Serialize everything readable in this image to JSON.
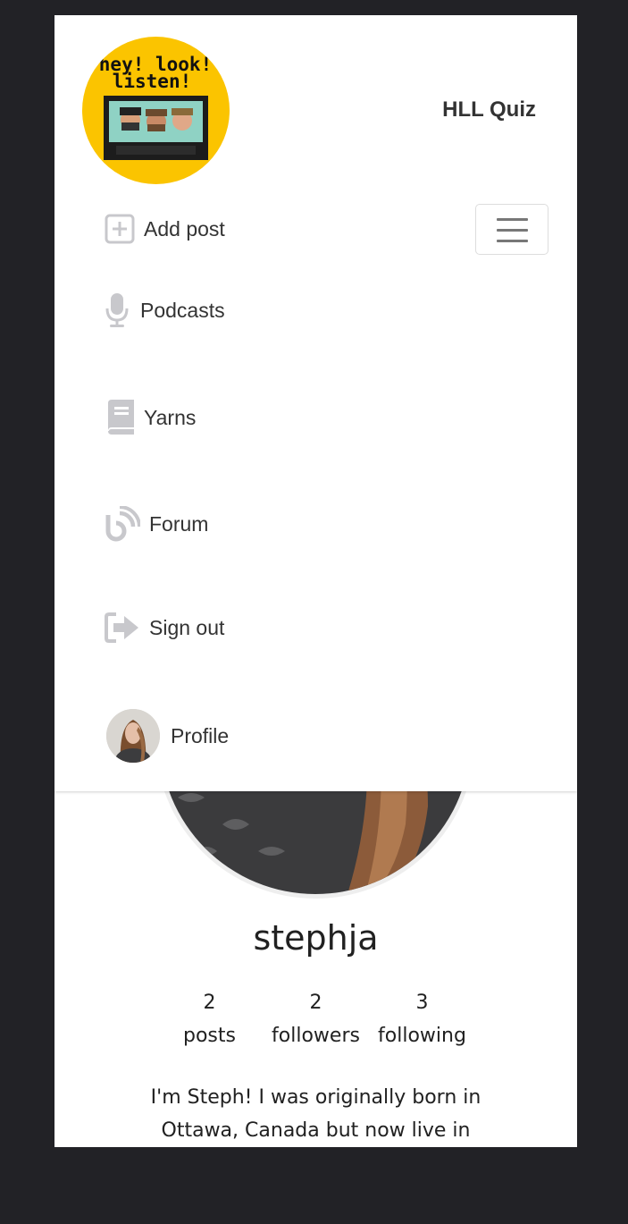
{
  "logo": {
    "text_line1": "hey! look!",
    "text_line2": "listen!",
    "bg_color": "#fbc400"
  },
  "header": {
    "quiz_link": "HLL Quiz"
  },
  "nav": {
    "toggler_icon": "hamburger-icon",
    "items": [
      {
        "label": "Add post",
        "icon": "plus-square-icon"
      },
      {
        "label": "Podcasts",
        "icon": "microphone-icon"
      },
      {
        "label": "Yarns",
        "icon": "book-icon"
      },
      {
        "label": "Forum",
        "icon": "blog-icon"
      },
      {
        "label": "Sign out",
        "icon": "sign-out-icon"
      },
      {
        "label": "Profile",
        "icon": "avatar"
      }
    ]
  },
  "profile": {
    "username": "stephja",
    "stats": [
      {
        "value": "2",
        "label": "posts"
      },
      {
        "value": "2",
        "label": "followers"
      },
      {
        "value": "3",
        "label": "following"
      }
    ],
    "bio": "I'm Steph! I was originally born in Ottawa, Canada but now live in"
  },
  "colors": {
    "background": "#222226",
    "icon_gray": "#c8c8cc",
    "text": "#333333"
  }
}
